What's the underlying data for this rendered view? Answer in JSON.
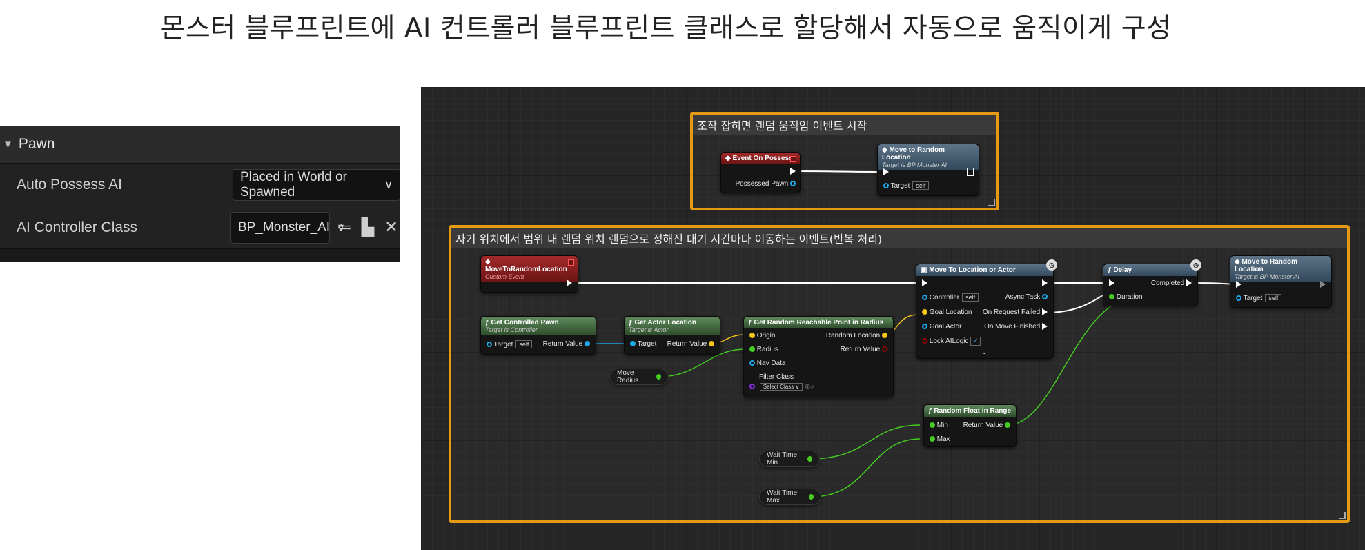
{
  "page_title": "몬스터 블루프린트에 AI 컨트롤러 블루프린트 클래스로 할당해서 자동으로 움직이게 구성",
  "details_panel": {
    "section": "Pawn",
    "rows": [
      {
        "label": "Auto Possess AI",
        "value": "Placed in World or Spawned"
      },
      {
        "label": "AI Controller Class",
        "value": "BP_Monster_AI"
      }
    ],
    "icons": [
      "browse-icon",
      "use-selected-icon",
      "clear-icon"
    ]
  },
  "graph": {
    "comment_possess": "조작 잡히면 랜덤 움직임 이벤트 시작",
    "comment_loop": "자기 위치에서 범위 내 랜덤 위치 랜덤으로 정해진 대기 시간마다 이동하는 이벤트(반복 처리)",
    "event_on_possess": {
      "title": "Event On Possess",
      "pin": "Possessed Pawn"
    },
    "move_random_1": {
      "title": "Move to Random Location",
      "subtitle": "Target is BP Monster AI",
      "target": "Target",
      "self": "self"
    },
    "custom_event": {
      "title": "MoveToRandomLocation",
      "subtitle": "Custom Event"
    },
    "get_pawn": {
      "title": "Get Controlled Pawn",
      "subtitle": "Target is Controller",
      "target": "Target",
      "self": "self",
      "ret": "Return Value"
    },
    "get_loc": {
      "title": "Get Actor Location",
      "subtitle": "Target is Actor",
      "target": "Target",
      "ret": "Return Value"
    },
    "random_point": {
      "title": "Get Random Reachable Point in Radius",
      "origin": "Origin",
      "radius": "Radius",
      "navdata": "Nav Data",
      "filter": "Filter Class",
      "select": "Select Class",
      "randloc": "Random Location",
      "ret": "Return Value"
    },
    "move_radius": "Move Radius",
    "move_to": {
      "title": "Move To Location or Actor",
      "controller": "Controller",
      "self": "self",
      "goal_loc": "Goal Location",
      "goal_actor": "Goal Actor",
      "lock": "Lock AILogic",
      "async": "Async Task",
      "failed": "On Request Failed",
      "finished": "On Move Finished"
    },
    "delay": {
      "title": "Delay",
      "completed": "Completed",
      "duration": "Duration"
    },
    "move_random_2": {
      "title": "Move to Random Location",
      "subtitle": "Target is BP Monster AI",
      "target": "Target",
      "self": "self"
    },
    "random_float": {
      "title": "Random Float in Range",
      "min": "Min",
      "max": "Max",
      "ret": "Return Value"
    },
    "wait_min": "Wait Time Min",
    "wait_max": "Wait Time Max"
  },
  "colors": {
    "comment_border": "#e69a12",
    "exec": "#ffffff",
    "vector": "#f5c518",
    "float": "#44cc22",
    "object": "#1fa8e8",
    "bool": "#8b0000"
  }
}
